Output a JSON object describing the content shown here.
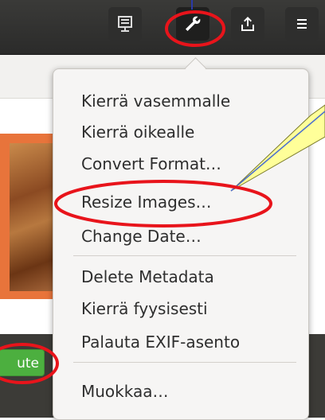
{
  "header": {
    "buttons": [
      {
        "name": "presentation",
        "icon": "presentation-icon"
      },
      {
        "name": "tools",
        "icon": "wrench-icon"
      },
      {
        "name": "share",
        "icon": "share-icon"
      },
      {
        "name": "menu",
        "icon": "hamburger-menu-icon"
      }
    ]
  },
  "menu": {
    "items": [
      "Kierrä vasemmalle",
      "Kierrä oikealle",
      "Convert Format…",
      "Resize Images…",
      "Change Date…",
      "Delete Metadata",
      "Kierrä fyysisesti",
      "Palauta EXIF-asento",
      "Muokkaa…"
    ]
  },
  "bottom": {
    "green_button_label": "ute"
  },
  "colors": {
    "annotation_red": "#e8141b",
    "callout_yellow": "#ffff99",
    "green_button": "#4caf3f",
    "thumbnail_border": "#e8743b"
  }
}
